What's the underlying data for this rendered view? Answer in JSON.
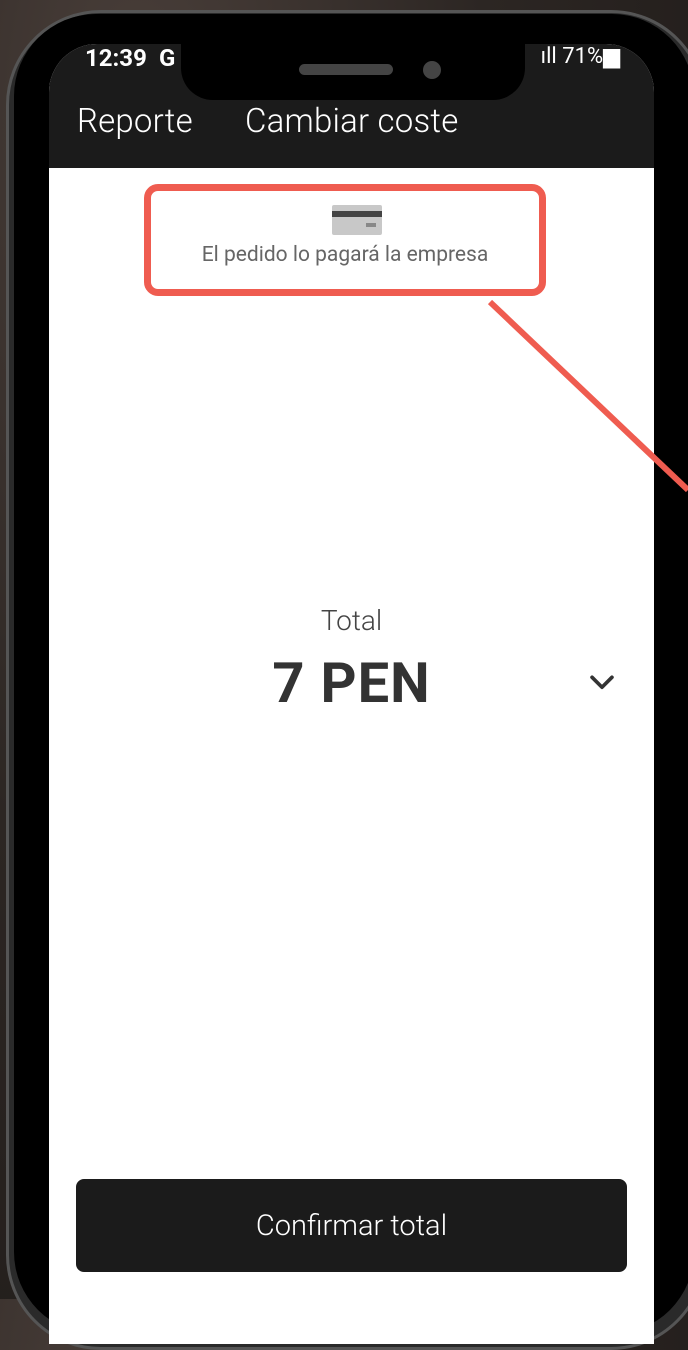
{
  "status_bar": {
    "time": "12:39",
    "g_icon": "G",
    "right": "ıll 71%▆"
  },
  "nav": {
    "report": "Reporte",
    "change_cost": "Cambiar coste"
  },
  "payment": {
    "icon": "credit-card-icon",
    "text": "El pedido lo pagará la empresa"
  },
  "total": {
    "label": "Total",
    "value": "7 PEN",
    "toggle_icon": "chevron-down-icon"
  },
  "confirm": {
    "label": "Confirmar total"
  },
  "colors": {
    "accent": "#ef5c50",
    "dark": "#1b1b1b"
  }
}
